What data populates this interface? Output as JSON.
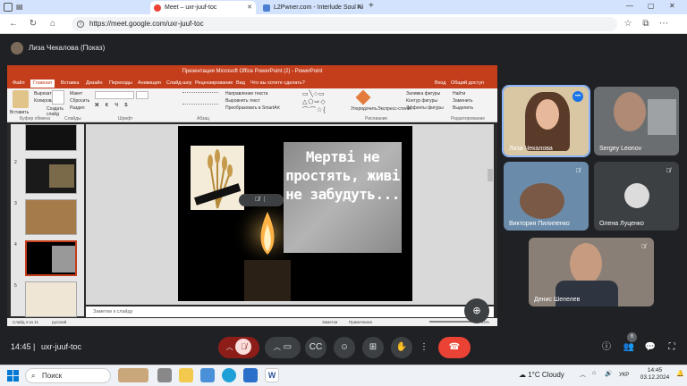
{
  "browser": {
    "tabs": [
      {
        "label": "Meet – uxr-juuf-toc",
        "active": true
      },
      {
        "label": "L2Pwner.com - Interlude Soul Ni",
        "active": false
      }
    ],
    "url": "https://meet.google.com/uxr-juuf-toc"
  },
  "meet": {
    "presenter": "Лиза Чекалова (Показ)",
    "time": "14:45",
    "code": "uxr-juuf-toc",
    "participants_count": "6",
    "participants": [
      {
        "name": "Лиза Чекалова",
        "muted": false,
        "speaking": true
      },
      {
        "name": "Sergey Leonov",
        "muted": false
      },
      {
        "name": "Виктория Пилипенко",
        "muted": true
      },
      {
        "name": "Олена Луценко",
        "muted": true
      },
      {
        "name": "Денис Шепелев",
        "muted": true
      }
    ],
    "colors": {
      "end_call": "#ea4335",
      "mic_off": "#8c1d18",
      "accent": "#8ab4f8"
    }
  },
  "ppt": {
    "title": "Презентация Microsoft Office PowerPoint (2) - PowerPoint",
    "tabs": [
      "Файл",
      "Главная",
      "Вставка",
      "Дизайн",
      "Переходы",
      "Анимация",
      "Слайд-шоу",
      "Рецензирование",
      "Вид",
      "Что вы хотите сделать?"
    ],
    "ribbon": {
      "paste": "Вставить",
      "cut": "Вырезать",
      "copy": "Копировать",
      "new_slide": "Создать слайд",
      "layout": "Макет",
      "reset": "Сбросить",
      "section": "Раздел",
      "clipboard": "Буфер обмена",
      "slides": "Слайды",
      "font": "Шрифт",
      "paragraph": "Абзац",
      "text_dir": "Направление текста",
      "align_text": "Выровнять текст",
      "smartart": "Преобразовать в SmartArt",
      "arrange": "Упорядочить",
      "quick_styles": "Экспресс-стили",
      "fill": "Заливка фигуры",
      "outline": "Контур фигуры",
      "effects": "Эффекты фигуры",
      "find": "Найти",
      "replace": "Заменить",
      "select": "Выделить",
      "drawing": "Рисование",
      "editing": "Редактирование",
      "login": "Вход",
      "share": "Общий доступ"
    },
    "slide_numbers": [
      "2",
      "3",
      "4",
      "5"
    ],
    "slide_text": "Мертві не простять, живі не забудуть...",
    "notes": "Заметки к слайду",
    "status": {
      "slide": "Слайд 4 из 11",
      "lang": "русский",
      "notes": "Заметки",
      "comments": "Примечания",
      "zoom": "45%"
    }
  },
  "taskbar": {
    "search": "Поиск",
    "weather": "1°C  Cloudy",
    "lang": "УКР",
    "time": "14:45",
    "date": "03.12.2024"
  }
}
